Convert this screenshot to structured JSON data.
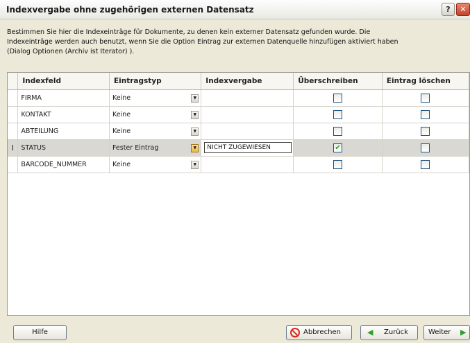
{
  "window": {
    "title": "Indexvergabe ohne zugehörigen externen Datensatz",
    "help_glyph": "?",
    "close_glyph": "✕"
  },
  "description": "Bestimmen Sie hier die Indexeinträge für  Dokumente, zu denen kein externer Datensatz gefunden wurde. Die\nIndexeinträge werden auch benutzt, wenn Sie die Option Eintrag zur externen Datenquelle hinzufügen aktiviert haben\n(Dialog Optionen (Archiv ist Iterator) ).",
  "grid": {
    "columns": [
      "Indexfeld",
      "Eintragstyp",
      "Indexvergabe",
      "Überschreiben",
      "Eintrag löschen"
    ],
    "rows": [
      {
        "indicator": "",
        "field": "FIRMA",
        "type": "Keine",
        "value": "",
        "overwrite": false,
        "delete": false
      },
      {
        "indicator": "",
        "field": "KONTAKT",
        "type": "Keine",
        "value": "",
        "overwrite": false,
        "delete": false
      },
      {
        "indicator": "",
        "field": "ABTEILUNG",
        "type": "Keine",
        "value": "",
        "overwrite": false,
        "delete": false
      },
      {
        "indicator": "I",
        "field": "STATUS",
        "type": "Fester Eintrag",
        "value": "NICHT ZUGEWIESEN",
        "overwrite": true,
        "delete": false,
        "selected": true
      },
      {
        "indicator": "",
        "field": "BARCODE_NUMMER",
        "type": "Keine",
        "value": "",
        "overwrite": false,
        "delete": false
      }
    ]
  },
  "footer": {
    "help_label": "Hilfe",
    "cancel_label": "Abbrechen",
    "back_label": "Zurück",
    "next_label": "Weiter"
  },
  "colors": {
    "dialog_bg": "#ece9d8",
    "selected_row": "#d9d8d3",
    "check_green": "#21a121",
    "cancel_red": "#d52b1e",
    "arrow_green": "#2f9e2f"
  }
}
